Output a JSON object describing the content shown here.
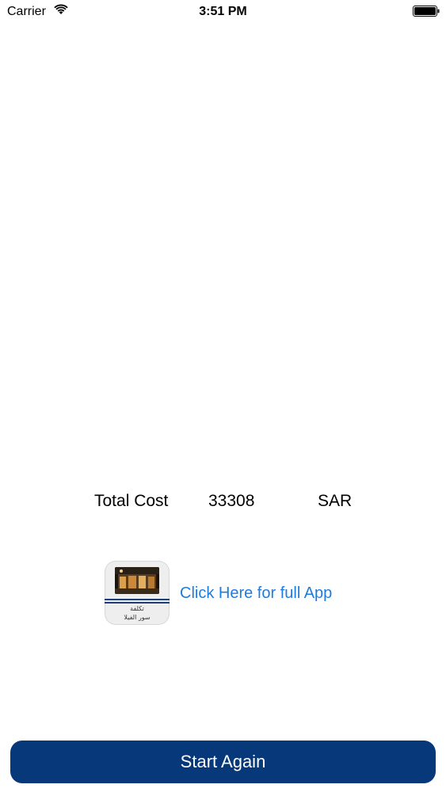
{
  "status_bar": {
    "carrier": "Carrier",
    "time": "3:51 PM",
    "wifi_icon": "wifi-icon",
    "battery_icon": "battery-icon"
  },
  "result": {
    "label": "Total Cost",
    "value": "33308",
    "currency": "SAR"
  },
  "promo": {
    "app_icon_caption_line1": "تكلفة",
    "app_icon_caption_line2": "سور الفيلا",
    "link_text": "Click Here for full App",
    "link_color": "#1e7ce0"
  },
  "actions": {
    "start_again_label": "Start Again",
    "button_color": "#07397a"
  }
}
